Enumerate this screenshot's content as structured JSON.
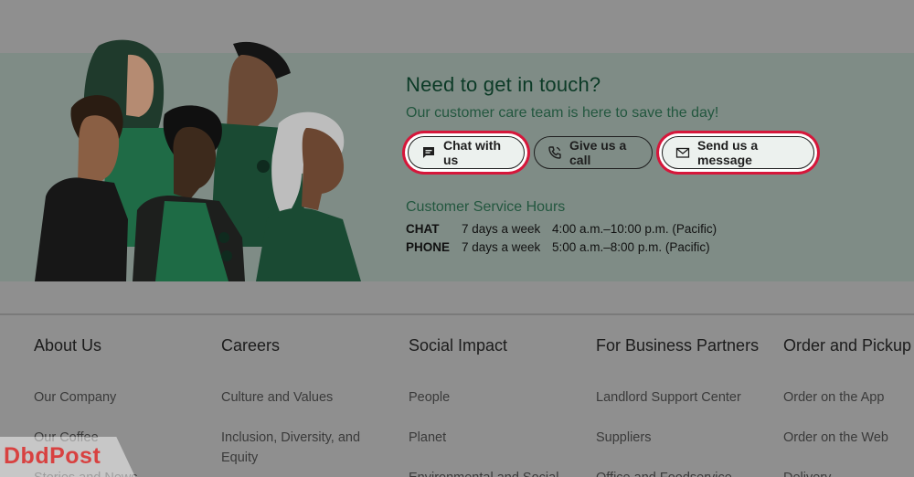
{
  "contact": {
    "title": "Need to get in touch?",
    "subtitle": "Our customer care team is here to save the day!",
    "buttons": {
      "chat": "Chat with us",
      "call": "Give us a call",
      "message": "Send us a message"
    },
    "hours_title": "Customer Service Hours",
    "hours": [
      {
        "channel": "CHAT",
        "days": "7 days a week",
        "time": "4:00 a.m.–10:00 p.m. (Pacific)"
      },
      {
        "channel": "PHONE",
        "days": "7 days a week",
        "time": "5:00 a.m.–8:00 p.m. (Pacific)"
      }
    ]
  },
  "footer": {
    "columns": [
      {
        "heading": "About Us",
        "links": [
          "Our Company",
          "Our Coffee",
          "Stories and News"
        ]
      },
      {
        "heading": "Careers",
        "links": [
          "Culture and Values",
          "Inclusion, Diversity, and Equity"
        ]
      },
      {
        "heading": "Social Impact",
        "links": [
          "People",
          "Planet",
          "Environmental and Social"
        ]
      },
      {
        "heading": "For Business Partners",
        "links": [
          "Landlord Support Center",
          "Suppliers",
          "Office and Foodservice"
        ]
      },
      {
        "heading": "Order and Pickup",
        "links": [
          "Order on the App",
          "Order on the Web",
          "Delivery"
        ]
      }
    ]
  },
  "watermark": {
    "text": "DbdPost"
  },
  "colors": {
    "highlight_ring": "#d6163a",
    "brand_green": "#0b3a26",
    "accent_green": "#23573f"
  }
}
